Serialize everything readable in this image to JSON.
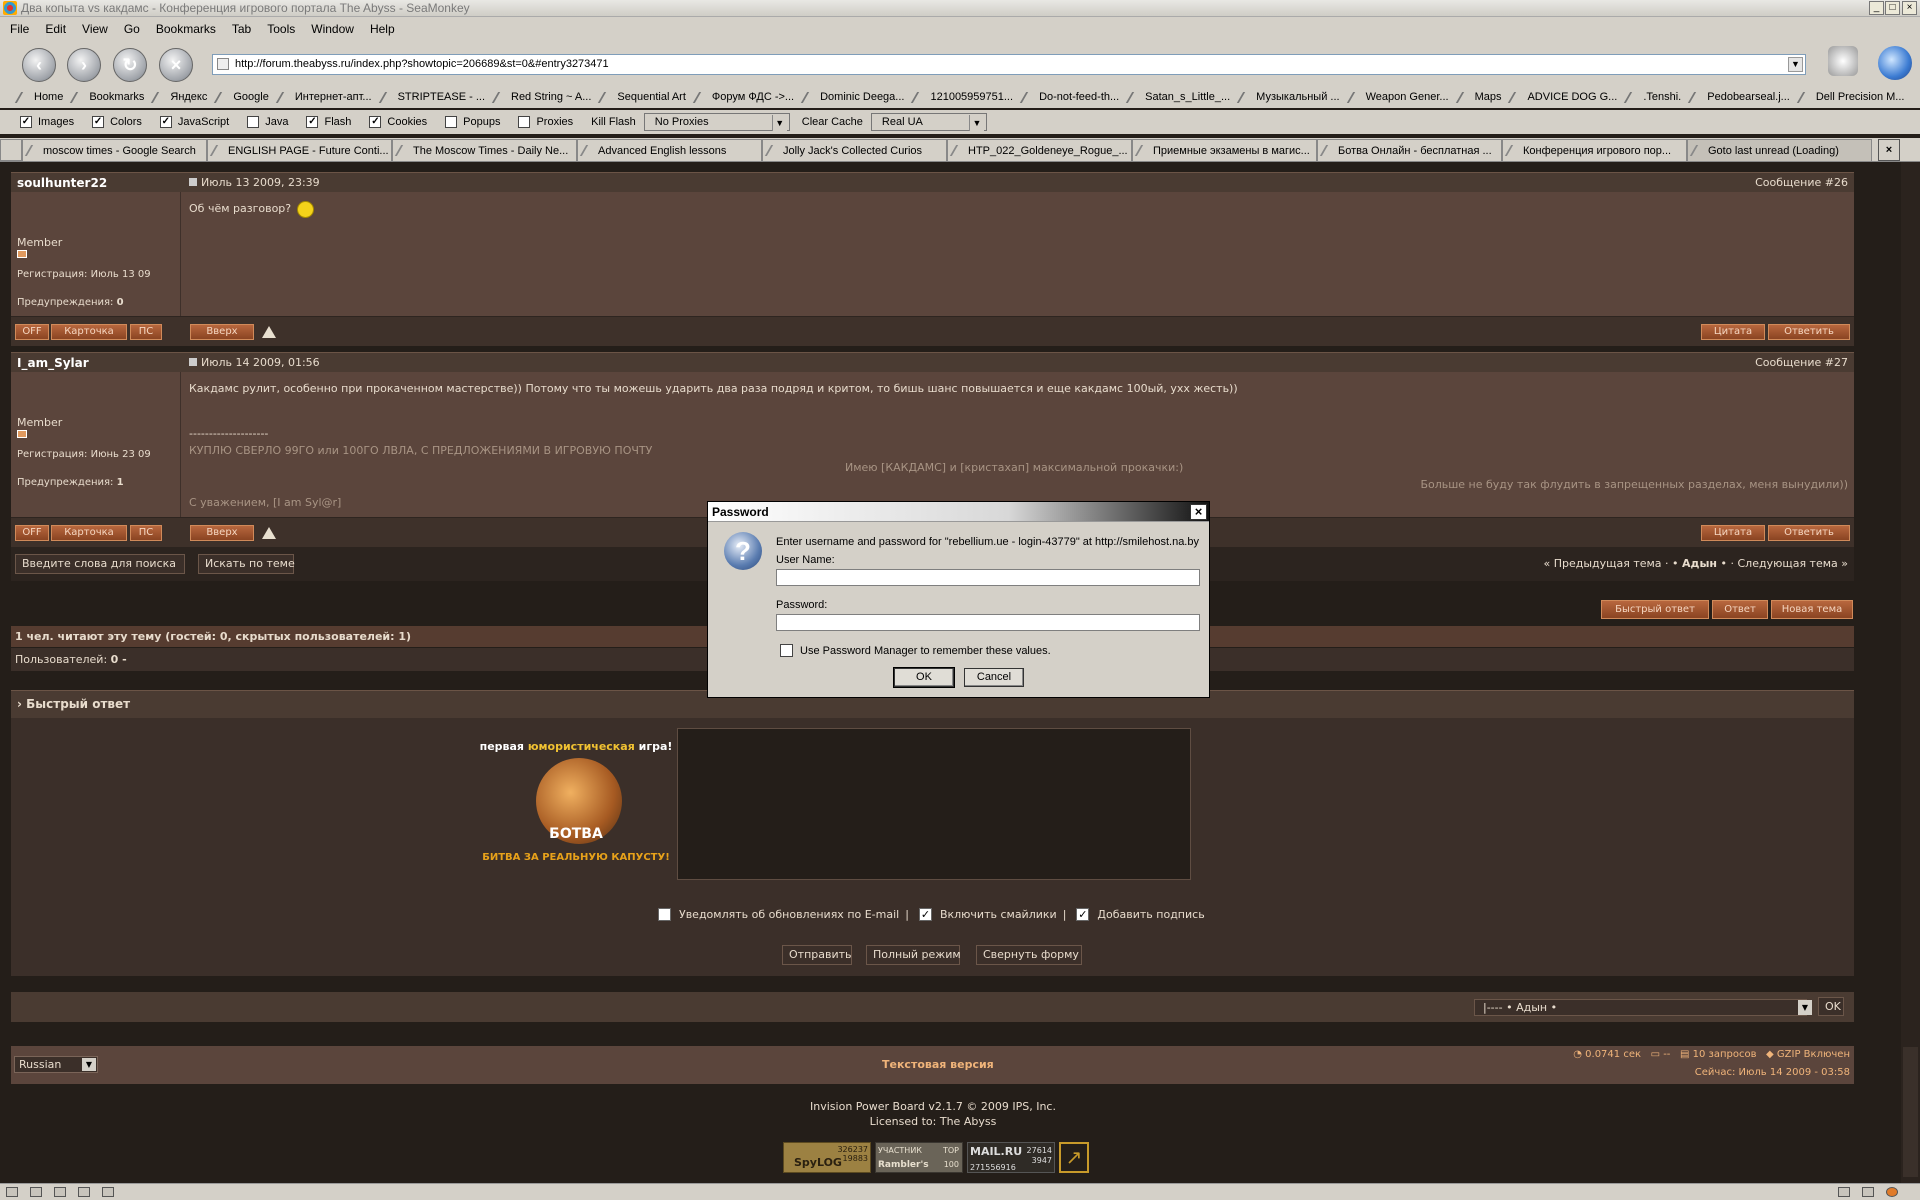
{
  "window": {
    "title": "Два копыта vs какдамс - Конференция игрового портала The Abyss - SeaMonkey"
  },
  "menu": [
    "File",
    "Edit",
    "View",
    "Go",
    "Bookmarks",
    "Tab",
    "Tools",
    "Window",
    "Help"
  ],
  "url": "http://forum.theabyss.ru/index.php?showtopic=206689&st=0&#entry3273471",
  "bookmarks": [
    "Home",
    "Bookmarks",
    "Яндекс",
    "Google",
    "Интернет-апт...",
    "STRIPTEASE - ...",
    "Red String ~ A...",
    "Sequential Art",
    "Форум ФДС ->...",
    "Dominic Deega...",
    "121005959751...",
    "Do-not-feed-th...",
    "Satan_s_Little_...",
    "Музыкальный ...",
    "Weapon Gener...",
    "Maps",
    "ADVICE DOG G...",
    ".Tenshi.",
    "Pedobearseal.j...",
    "Dell Precision M..."
  ],
  "prefbar": {
    "checks": [
      {
        "label": "Images",
        "checked": true
      },
      {
        "label": "Colors",
        "checked": true
      },
      {
        "label": "JavaScript",
        "checked": true
      },
      {
        "label": "Java",
        "checked": false
      },
      {
        "label": "Flash",
        "checked": true
      },
      {
        "label": "Cookies",
        "checked": true
      },
      {
        "label": "Popups",
        "checked": false
      },
      {
        "label": "Proxies",
        "checked": false
      }
    ],
    "kill_flash": "Kill Flash",
    "proxy": "No Proxies",
    "clear_cache": "Clear Cache",
    "ua": "Real UA"
  },
  "tabs": [
    "moscow times - Google Search",
    "ENGLISH PAGE - Future Conti...",
    "The Moscow Times - Daily Ne...",
    "Advanced English lessons",
    "Jolly Jack's Collected Curios",
    "HTP_022_Goldeneye_Rogue_...",
    "Приемные экзамены в магис...",
    "Ботва Онлайн - бесплатная ...",
    "Конференция игрового пор...",
    "Goto last unread (Loading)"
  ],
  "posts": [
    {
      "author": "soulhunter22",
      "date": "Июль 13 2009, 23:39",
      "num": "Сообщение #26",
      "group": "Member",
      "reg": "Регистрация: Июль 13 09",
      "warn_label": "Предупреждения:",
      "warn": "0",
      "text": "Об чём разговор?"
    },
    {
      "author": "I_am_Sylar",
      "date": "Июль 14 2009, 01:56",
      "num": "Сообщение #27",
      "group": "Member",
      "reg": "Регистрация: Июнь 23 09",
      "warn_label": "Предупреждения:",
      "warn": "1",
      "text": "Какдамс рулит, особенно при прокаченном мастерстве)) Потому что ты можешь ударить два раза подряд и критом, то бишь шанс повышается и еще какдамс 100ый, ухх жесть))",
      "sig_sep": "--------------------",
      "sig1": "КУПЛЮ СВЕРЛО 99ГО или 100ГО ЛВЛА, С ПРЕДЛОЖЕНИЯМИ В ИГРОВУЮ ПОЧТУ",
      "sig2": "Имею [КАКДАМС] и [кристахап] максимальной прокачки:)",
      "sig3": "Больше не буду так флудить в запрещенных разделах, меня вынудили))",
      "sig4": "С уважением, [I am Syl@r]"
    }
  ],
  "post_buttons": {
    "off": "OFF",
    "card": "Карточка",
    "pm": "ПС",
    "top": "Вверх",
    "quote": "Цитата",
    "reply": "Ответить"
  },
  "search": {
    "input": "Введите слова для поиска",
    "button": "Искать по теме"
  },
  "topic_nav": {
    "prev": "« Предыдущая тема",
    "forum": "Адын",
    "next": "Следующая тема »"
  },
  "action_buttons": {
    "fast": "Быстрый ответ",
    "reply": "Ответ",
    "new": "Новая тема"
  },
  "readers": {
    "title": "1 чел. читают эту тему (гостей: 0, скрытых пользователей: 1)",
    "users_label": "Пользователей:",
    "users": "0 -"
  },
  "quick_reply": {
    "title": "Быстрый ответ",
    "ad_top_1": "первая",
    "ad_top_2": "юмористическая",
    "ad_top_3": "игра!",
    "ad_logo": "БОТВА",
    "ad_bottom": "БИТВА ЗА РЕАЛЬНУЮ КАПУСТУ!",
    "opt1": "Уведомлять об обновлениях по E-mail",
    "opt2": "Включить смайлики",
    "opt3": "Добавить подпись",
    "sep": "|",
    "send": "Отправить",
    "full": "Полный режим",
    "collapse": "Свернуть форму"
  },
  "jump": {
    "value": "|---- • Адын •",
    "ok": "OK"
  },
  "footer": {
    "lang": "Russian",
    "text_version": "Текстовая версия",
    "time": "0.0741 сек",
    "dash": "--",
    "queries": "10 запросов",
    "gzip": "GZIP Включен",
    "now": "Сейчас: Июль 14 2009 - 03:58",
    "copyright1": "Invision Power Board v2.1.7 © 2009  IPS, Inc.",
    "copyright2": "Licensed to: The Abyss",
    "counters": [
      "326237",
      "19883",
      "SpyLOG",
      "УЧАСТНИК",
      "TOP",
      "Rambler's",
      "100",
      "MAIL.RU",
      "27614",
      "3947",
      "271556916"
    ]
  },
  "dialog": {
    "title": "Password",
    "message": "Enter username and password for \"rebellium.ue - login-43779\" at http://smilehost.na.by",
    "user_label": "User Name:",
    "pass_label": "Password:",
    "remember": "Use Password Manager to remember these values.",
    "ok": "OK",
    "cancel": "Cancel"
  }
}
